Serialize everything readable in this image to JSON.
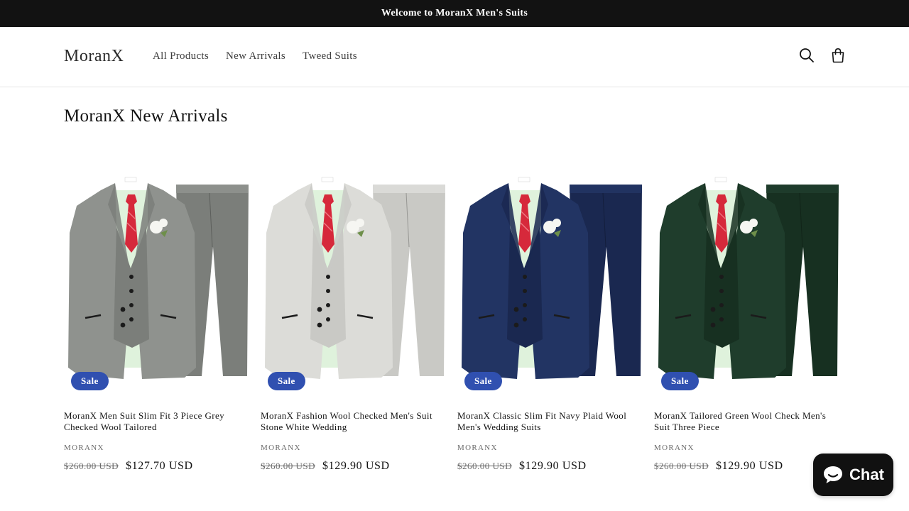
{
  "announcement": {
    "text": "Welcome to MoranX Men's Suits"
  },
  "header": {
    "logo": "MoranX",
    "nav": [
      "All Products",
      "New Arrivals",
      "Tweed Suits"
    ],
    "icons": {
      "search": "search-icon",
      "cart": "cart-icon"
    }
  },
  "section": {
    "title": "MoranX New Arrivals"
  },
  "products": [
    {
      "title": "MoranX Men Suit Slim Fit 3 Piece Grey Checked Wool Tailored",
      "vendor": "MORANX",
      "badge": "Sale",
      "compare_price": "$260.00 USD",
      "price": "$127.70 USD",
      "suit_color": "#8f928e",
      "suit_shade": "#7b7e7a"
    },
    {
      "title": "MoranX Fashion Wool Checked Men's Suit Stone White Wedding",
      "vendor": "MORANX",
      "badge": "Sale",
      "compare_price": "$260.00 USD",
      "price": "$129.90 USD",
      "suit_color": "#dcdcd8",
      "suit_shade": "#c9c9c5"
    },
    {
      "title": "MoranX Classic Slim Fit Navy Plaid Wool Men's Wedding Suits",
      "vendor": "MORANX",
      "badge": "Sale",
      "compare_price": "$260.00 USD",
      "price": "$129.90 USD",
      "suit_color": "#223463",
      "suit_shade": "#1a2850"
    },
    {
      "title": "MoranX Tailored Green Wool Check Men's Suit Three Piece",
      "vendor": "MORANX",
      "badge": "Sale",
      "compare_price": "$260.00 USD",
      "price": "$129.90 USD",
      "suit_color": "#1f3d2c",
      "suit_shade": "#173021"
    }
  ],
  "chat": {
    "label": "Chat",
    "icon": "chat-bubble-icon"
  },
  "colors": {
    "accent": "#3050b0",
    "announcement_bg": "#121212",
    "chat_bg": "#111111"
  }
}
